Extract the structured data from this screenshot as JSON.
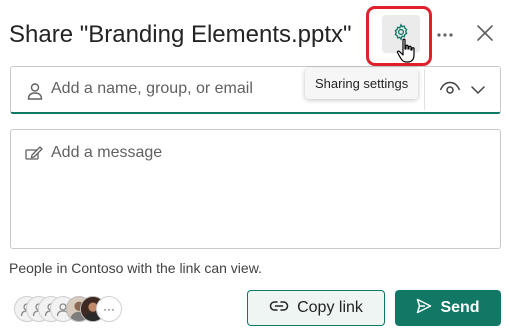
{
  "dialog": {
    "title": "Share \"Branding Elements.pptx\"",
    "tooltip": "Sharing settings"
  },
  "people_input": {
    "placeholder": "Add a name, group, or email",
    "permission_icon": "eye-icon"
  },
  "message_input": {
    "placeholder": "Add a message"
  },
  "link_info": "People in Contoso with the link can view.",
  "avatars": {
    "more_label": "···"
  },
  "buttons": {
    "copy_link": "Copy link",
    "send": "Send"
  },
  "colors": {
    "accent": "#117865",
    "highlight": "#e0202b"
  }
}
